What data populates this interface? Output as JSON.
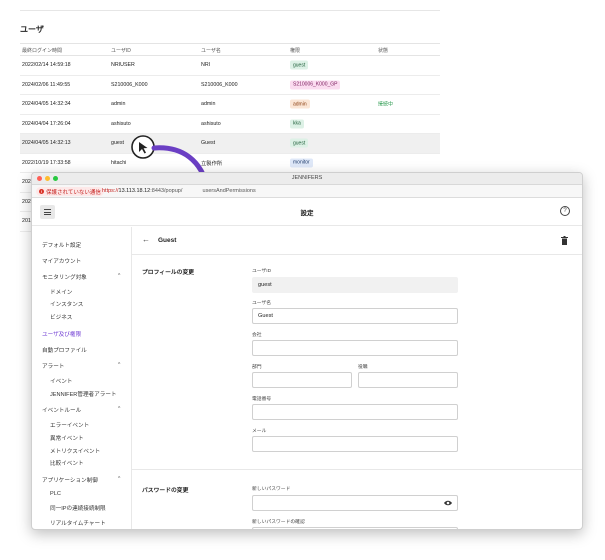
{
  "background": {
    "title": "ユーザ",
    "columns": [
      "最終ログイン時間",
      "ユーザID",
      "ユーザ名",
      "権限",
      "状態"
    ],
    "rows": [
      {
        "time": "2022/02/14 14:59:18",
        "id": "NRIUSER",
        "name": "NRI",
        "role": "guest",
        "role_style": "green",
        "status": ""
      },
      {
        "time": "2024/02/06 11:49:55",
        "id": "S210006_K000",
        "name": "S210006_K000",
        "role": "S210006_K000_GP",
        "role_style": "pink",
        "status": ""
      },
      {
        "time": "2024/04/05 14:32:34",
        "id": "admin",
        "name": "admin",
        "role": "admin",
        "role_style": "orange",
        "status": "接続中"
      },
      {
        "time": "2024/04/04 17:26:04",
        "id": "ashisuto",
        "name": "ashisuto",
        "role": "kka",
        "role_style": "green",
        "status": ""
      },
      {
        "time": "2024/04/05 14:32:13",
        "id": "guest",
        "name": "Guest",
        "role": "guest",
        "role_style": "green",
        "status": ""
      },
      {
        "time": "2022/10/19 17:33:58",
        "id": "hitachi",
        "name": "立製作所",
        "role": "monitor",
        "role_style": "blue",
        "status": ""
      }
    ],
    "partial_rows": [
      "202",
      "202",
      "201"
    ]
  },
  "popup": {
    "window_title": "JENNIFERS",
    "url_warning": "保護されていない通信",
    "url_scheme": "https://",
    "url_host": "13.113.18.12",
    "url_rest": ":8443/popup/",
    "url_tail": "usersAndPermissions",
    "app_title": "設定",
    "sidebar": [
      {
        "label": "デフォルト設定",
        "level": 0
      },
      {
        "label": "マイアカウント",
        "level": 0
      },
      {
        "label": "モニタリング対象",
        "level": 0,
        "chevron": "^"
      },
      {
        "label": "ドメイン",
        "level": 1
      },
      {
        "label": "インスタンス",
        "level": 1
      },
      {
        "label": "ビジネス",
        "level": 1
      },
      {
        "label": "ユーザ及び権限",
        "level": 0,
        "active": true
      },
      {
        "label": "自動プロファイル",
        "level": 0
      },
      {
        "label": "アラート",
        "level": 0,
        "chevron": "^"
      },
      {
        "label": "イベント",
        "level": 1
      },
      {
        "label": "JENNIFER管理者アラート",
        "level": 1
      },
      {
        "label": "イベントルール",
        "level": 0,
        "chevron": "^"
      },
      {
        "label": "エラーイベント",
        "level": 1
      },
      {
        "label": "異常イベント",
        "level": 1
      },
      {
        "label": "メトリクスイベント",
        "level": 1
      },
      {
        "label": "比較イベント",
        "level": 1
      },
      {
        "label": "アプリケーション制御",
        "level": 0,
        "chevron": "^"
      },
      {
        "label": "PLC",
        "level": 1
      },
      {
        "label": "同一IPの連続接続制限",
        "level": 1
      },
      {
        "label": "リアルタイムチャート",
        "level": 1
      }
    ],
    "detail": {
      "title": "Guest",
      "profile_section": "プロフィールの変更",
      "user_id_label": "ユーザID",
      "user_id_value": "guest",
      "user_name_label": "ユーザ名",
      "user_name_value": "Guest",
      "company_label": "会社",
      "department_label": "部門",
      "position_label": "役職",
      "phone_label": "電話番号",
      "email_label": "メール",
      "password_section": "パスワードの変更",
      "new_password_label": "新しいパスワード",
      "confirm_password_label": "新しいパスワードの確認"
    }
  },
  "colors": {
    "accent": "#6f3bd3",
    "arrow": "#6b3fc4"
  }
}
